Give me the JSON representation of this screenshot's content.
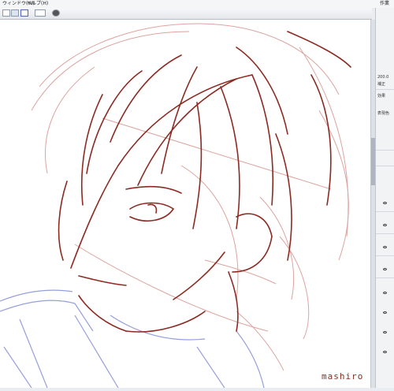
{
  "menu": {
    "window_label": "ウィンドウ(W)",
    "help_label": "ヘルプ(H)",
    "right_label": "作業"
  },
  "panel": {
    "value1": "200.0",
    "value2": "補正",
    "effect_label": "効果",
    "display_label": "表現色"
  },
  "canvas": {
    "signature": "mashiro"
  },
  "colors": {
    "line_red": "#8c2a22",
    "line_light": "#d99a95",
    "line_blue": "#8a95d8"
  },
  "icons": [
    "select-tool-icon",
    "move-tool-icon",
    "figure-icon",
    "view-icon",
    "help-icon"
  ]
}
